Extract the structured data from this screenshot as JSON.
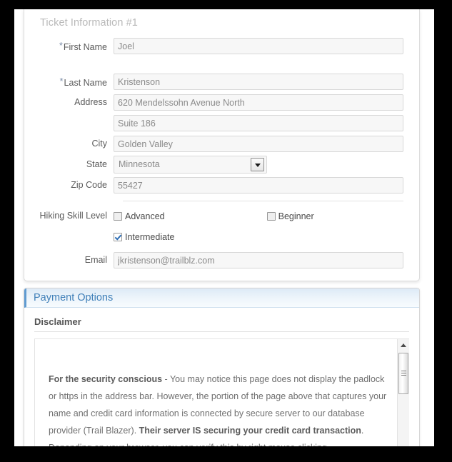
{
  "ticket": {
    "title": "Ticket Information #1",
    "fields": {
      "first_name_label": "First Name",
      "first_name_value": "Joel",
      "last_name_label": "Last Name",
      "last_name_value": "Kristenson",
      "address_label": "Address",
      "address_line1_value": "620 Mendelssohn Avenue North",
      "address_line2_value": "Suite 186",
      "city_label": "City",
      "city_value": "Golden Valley",
      "state_label": "State",
      "state_value": "Minnesota",
      "zip_label": "Zip Code",
      "zip_value": "55427",
      "skill_label": "Hiking Skill Level",
      "email_label": "Email",
      "email_value": "jkristenson@trailblz.com"
    },
    "required_marker": "*",
    "skill_options": [
      {
        "label": "Advanced",
        "checked": false
      },
      {
        "label": "Beginner",
        "checked": false
      },
      {
        "label": "Intermediate",
        "checked": true
      }
    ]
  },
  "payment": {
    "header": "Payment Options",
    "disclaimer_title": "Disclaimer",
    "disclaimer_lead": "For the security conscious",
    "disclaimer_part1": " - You may notice this page does not display the padlock or https in the address bar.  However, the portion of the page above that captures your name and credit card information is connected by secure server to our database provider (Trail Blazer).  ",
    "disclaimer_bold2": "Their server IS securing your credit card transaction",
    "disclaimer_part2": ". Depending on your browser, you can verify this by right mouse clicking"
  },
  "icons": {
    "dropdown": "chevron-down-icon",
    "scroll_up": "scroll-up-arrow-icon",
    "scroll_down": "scroll-down-arrow-icon"
  },
  "colors": {
    "accent_blue": "#3f7fb8",
    "header_gradient_top": "#ddeaf6",
    "checkbox_check": "#2f6fb5",
    "label_text": "#5a5a5a",
    "input_text": "#8a8a8a"
  }
}
